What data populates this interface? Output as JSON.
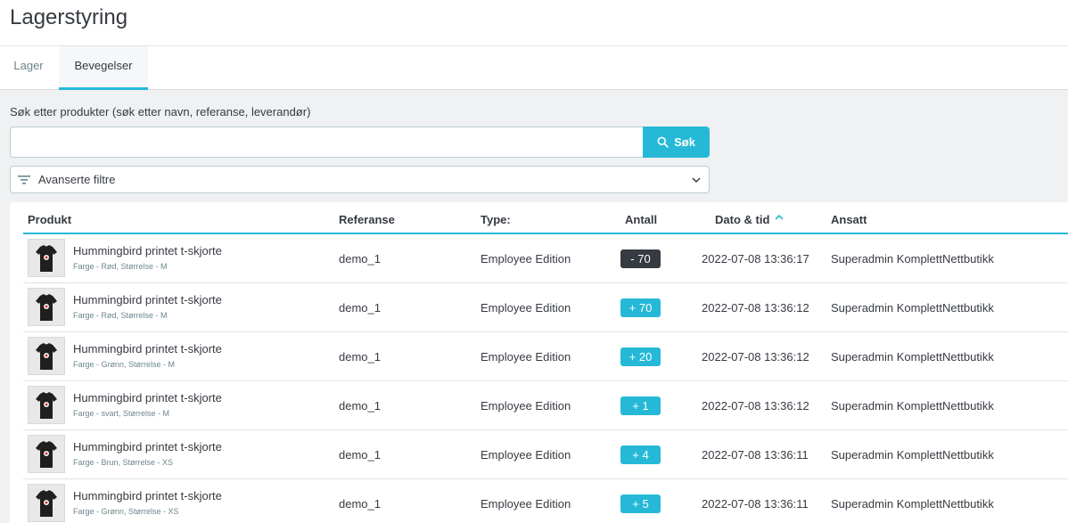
{
  "page_title": "Lagerstyring",
  "tabs": [
    {
      "label": "Lager",
      "active": false
    },
    {
      "label": "Bevegelser",
      "active": true
    }
  ],
  "search": {
    "label": "Søk etter produkter (søk etter navn, referanse, leverandør)",
    "value": "",
    "placeholder": "",
    "button_label": "Søk"
  },
  "filters": {
    "label": "Avanserte filtre"
  },
  "table": {
    "headers": {
      "produkt": "Produkt",
      "referanse": "Referanse",
      "type": "Type:",
      "antall": "Antall",
      "dato": "Dato & tid",
      "ansatt": "Ansatt"
    },
    "sort_column": "Dato & tid",
    "rows": [
      {
        "name": "Hummingbird printet t-skjorte",
        "attributes": "Farge - Rød, Størrelse - M",
        "reference": "demo_1",
        "type": "Employee Edition",
        "quantity": "- 70",
        "quantity_sign": "negative",
        "datetime": "2022-07-08 13:36:17",
        "employee": "Superadmin KomplettNettbutikk"
      },
      {
        "name": "Hummingbird printet t-skjorte",
        "attributes": "Farge - Rød, Størrelse - M",
        "reference": "demo_1",
        "type": "Employee Edition",
        "quantity": "+ 70",
        "quantity_sign": "positive",
        "datetime": "2022-07-08 13:36:12",
        "employee": "Superadmin KomplettNettbutikk"
      },
      {
        "name": "Hummingbird printet t-skjorte",
        "attributes": "Farge - Grønn, Størrelse - M",
        "reference": "demo_1",
        "type": "Employee Edition",
        "quantity": "+ 20",
        "quantity_sign": "positive",
        "datetime": "2022-07-08 13:36:12",
        "employee": "Superadmin KomplettNettbutikk"
      },
      {
        "name": "Hummingbird printet t-skjorte",
        "attributes": "Farge - svart, Størrelse - M",
        "reference": "demo_1",
        "type": "Employee Edition",
        "quantity": "+ 1",
        "quantity_sign": "positive",
        "datetime": "2022-07-08 13:36:12",
        "employee": "Superadmin KomplettNettbutikk"
      },
      {
        "name": "Hummingbird printet t-skjorte",
        "attributes": "Farge - Brun, Størrelse - XS",
        "reference": "demo_1",
        "type": "Employee Edition",
        "quantity": "+ 4",
        "quantity_sign": "positive",
        "datetime": "2022-07-08 13:36:11",
        "employee": "Superadmin KomplettNettbutikk"
      },
      {
        "name": "Hummingbird printet t-skjorte",
        "attributes": "Farge - Grønn, Størrelse - XS",
        "reference": "demo_1",
        "type": "Employee Edition",
        "quantity": "+ 5",
        "quantity_sign": "positive",
        "datetime": "2022-07-08 13:36:11",
        "employee": "Superadmin KomplettNettbutikk"
      }
    ]
  },
  "colors": {
    "accent": "#25b9d7",
    "negative_badge": "#363a41",
    "text": "#363a41"
  }
}
